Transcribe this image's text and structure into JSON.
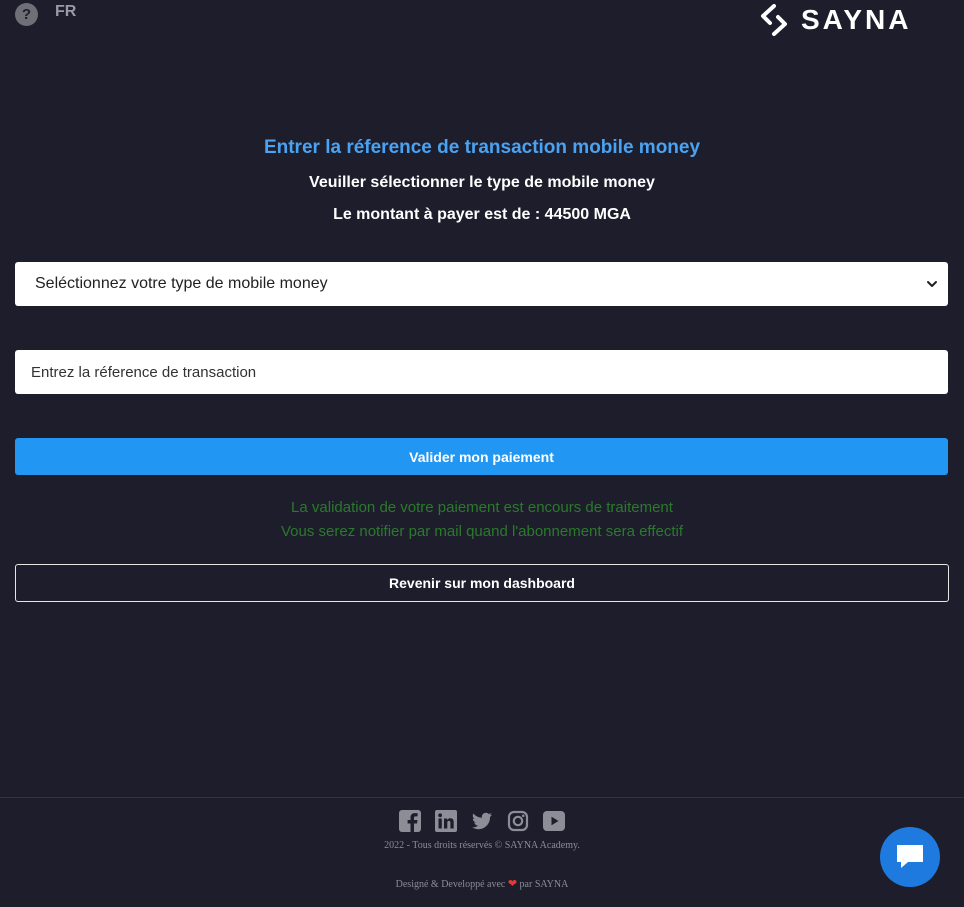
{
  "header": {
    "help_label": "?",
    "language": "FR",
    "logo_text": "SAYNA"
  },
  "main": {
    "title": "Entrer la réference de transaction mobile money",
    "subtitle": "Veuiller sélectionner le type de mobile money",
    "amount_text": "Le montant à payer est de : 44500 MGA"
  },
  "form": {
    "select_value": "Seléctionnez votre type de mobile money",
    "reference_placeholder": "Entrez la réference de transaction",
    "reference_value": "",
    "submit_label": "Valider mon paiement"
  },
  "status": {
    "line1": "La validation de votre paiement est encours de traitement",
    "line2": "Vous serez notifier par mail quand l'abonnement sera effectif"
  },
  "dashboard_button": "Revenir sur mon dashboard",
  "footer": {
    "socials": [
      "facebook-icon",
      "linkedin-icon",
      "twitter-icon",
      "instagram-icon",
      "youtube-icon"
    ],
    "copyright": "2022 - Tous droits réservés © SAYNA Academy.",
    "credits_prefix": "Designé & Developpé avec",
    "credits_suffix": "par SAYNA"
  },
  "colors": {
    "background": "#1d1d2c",
    "title": "#4aa3f2",
    "primary_button": "#2196f3",
    "status_text": "#2b7a2b",
    "chat_button": "#1f7ae0"
  }
}
